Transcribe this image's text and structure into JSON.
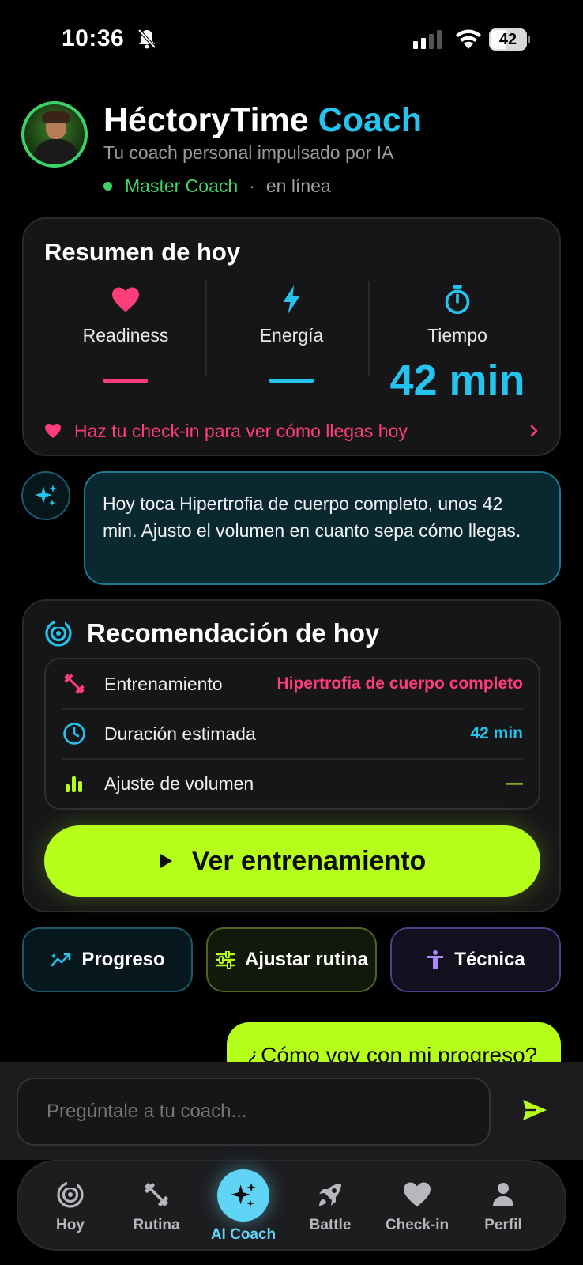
{
  "status_bar": {
    "time": "10:36",
    "battery": "42"
  },
  "header": {
    "title_main": "HéctoryTime",
    "title_accent": "Coach",
    "subtitle": "Tu coach personal impulsado por IA",
    "level": "Master Coach",
    "separator": "·",
    "online": "en línea"
  },
  "summary": {
    "title": "Resumen de hoy",
    "metrics": [
      {
        "label": "Readiness",
        "value": "",
        "icon": "heart-icon",
        "color": "#ff3d7a"
      },
      {
        "label": "Energía",
        "value": "",
        "icon": "bolt-icon",
        "color": "#24c4ef"
      },
      {
        "label": "Tiempo",
        "value": "42 min",
        "icon": "stopwatch-icon",
        "color": "#24c4ef"
      }
    ],
    "checkin_prompt": "Haz tu check-in para ver cómo llegas hoy"
  },
  "coach_message": "Hoy toca Hipertrofia de cuerpo completo, unos 42 min. Ajusto el volumen en cuanto sepa cómo llegas.",
  "recommendation": {
    "title": "Recomendación de hoy",
    "rows": [
      {
        "label": "Entrenamiento",
        "value": "Hipertrofia de cuerpo completo",
        "icon": "dumbbell-icon",
        "color": "#ff3d7a"
      },
      {
        "label": "Duración estimada",
        "value": "42 min",
        "icon": "clock-icon",
        "color": "#24c4ef"
      },
      {
        "label": "Ajuste de volumen",
        "value": "—",
        "icon": "bars-icon",
        "color": "#b6ff1a"
      }
    ],
    "cta_label": "Ver entrenamiento"
  },
  "quick_actions": [
    {
      "label": "Progreso",
      "icon": "trend-icon"
    },
    {
      "label": "Ajustar rutina",
      "icon": "sliders-icon"
    },
    {
      "label": "Técnica",
      "icon": "figure-icon"
    }
  ],
  "user_message": "¿Cómo voy con mi progreso?",
  "input": {
    "placeholder": "Pregúntale a tu coach..."
  },
  "nav": {
    "items": [
      {
        "label": "Hoy",
        "icon": "target-icon"
      },
      {
        "label": "Rutina",
        "icon": "dumbbell-icon"
      },
      {
        "label": "AI Coach",
        "icon": "sparkles-icon",
        "active": true
      },
      {
        "label": "Battle",
        "icon": "rocket-icon"
      },
      {
        "label": "Check-in",
        "icon": "heart-icon"
      },
      {
        "label": "Perfil",
        "icon": "user-icon"
      }
    ]
  },
  "colors": {
    "lime": "#b6ff1a",
    "cyan": "#24c4ef",
    "pink": "#ff3d7a",
    "green": "#3fd16a"
  }
}
